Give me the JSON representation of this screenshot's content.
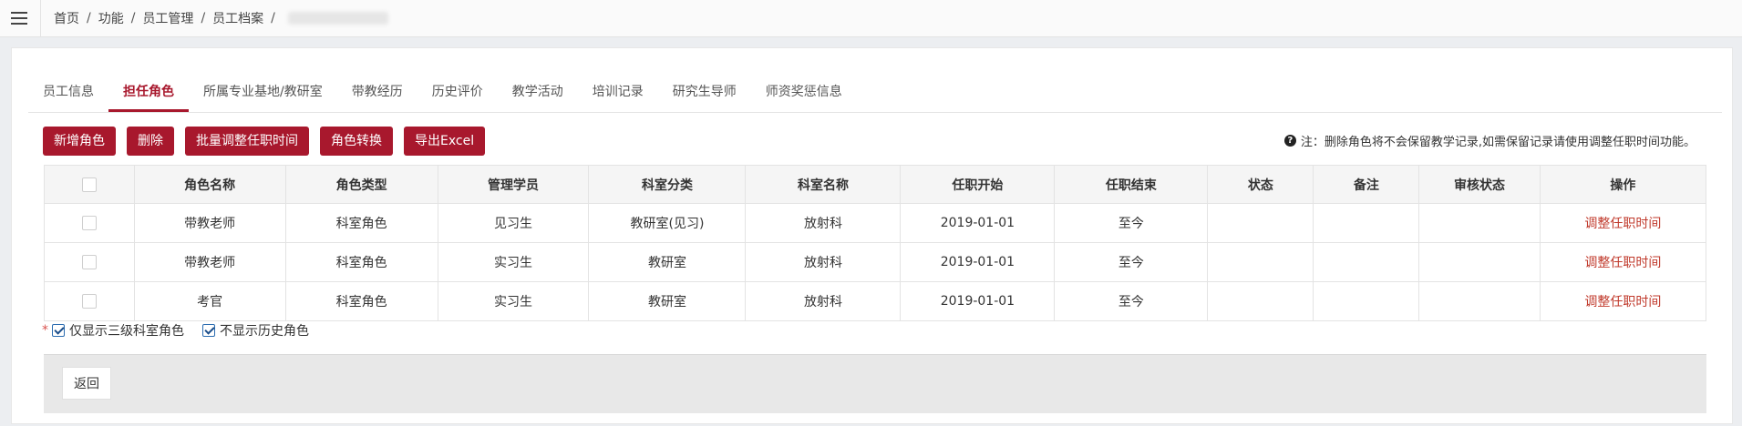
{
  "breadcrumb": [
    "首页",
    "功能",
    "员工管理",
    "员工档案"
  ],
  "tabs": [
    {
      "label": "员工信息",
      "active": false
    },
    {
      "label": "担任角色",
      "active": true
    },
    {
      "label": "所属专业基地/教研室",
      "active": false
    },
    {
      "label": "带教经历",
      "active": false
    },
    {
      "label": "历史评价",
      "active": false
    },
    {
      "label": "教学活动",
      "active": false
    },
    {
      "label": "培训记录",
      "active": false
    },
    {
      "label": "研究生导师",
      "active": false
    },
    {
      "label": "师资奖惩信息",
      "active": false
    }
  ],
  "toolbar": {
    "add": "新增角色",
    "delete": "删除",
    "batch_adjust": "批量调整任职时间",
    "convert": "角色转换",
    "export": "导出Excel"
  },
  "note": "注：删除角色将不会保留教学记录,如需保留记录请使用调整任职时间功能。",
  "table": {
    "headers": [
      "角色名称",
      "角色类型",
      "管理学员",
      "科室分类",
      "科室名称",
      "任职开始",
      "任职结束",
      "状态",
      "备注",
      "审核状态",
      "操作"
    ],
    "rows": [
      [
        "带教老师",
        "科室角色",
        "见习生",
        "教研室(见习)",
        "放射科",
        "2019-01-01",
        "至今",
        "",
        "",
        "",
        "调整任职时间"
      ],
      [
        "带教老师",
        "科室角色",
        "实习生",
        "教研室",
        "放射科",
        "2019-01-01",
        "至今",
        "",
        "",
        "",
        "调整任职时间"
      ],
      [
        "考官",
        "科室角色",
        "实习生",
        "教研室",
        "放射科",
        "2019-01-01",
        "至今",
        "",
        "",
        "",
        "调整任职时间"
      ]
    ]
  },
  "options": {
    "star": "*",
    "level3_only": "仅显示三级科室角色",
    "hide_history": "不显示历史角色"
  },
  "footer": {
    "back": "返回"
  },
  "colors": {
    "accent": "#a8182d",
    "link": "#c0392b"
  }
}
